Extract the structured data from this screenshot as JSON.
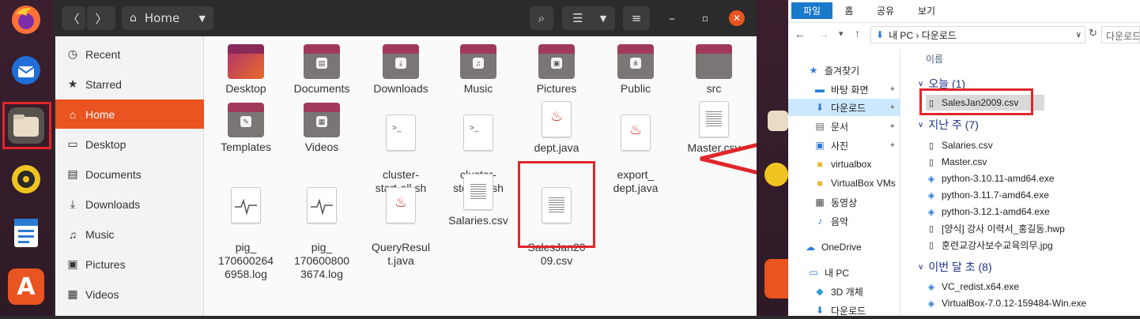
{
  "dock": {
    "items": [
      "firefox-icon",
      "thunderbird-icon",
      "files-icon",
      "rhythmbox-icon",
      "writer-icon",
      "app-center-icon"
    ]
  },
  "nautilus": {
    "path": "Home",
    "sidebar": [
      {
        "label": "Recent",
        "icon": "clock-icon"
      },
      {
        "label": "Starred",
        "icon": "star-icon"
      },
      {
        "label": "Home",
        "icon": "home-icon"
      },
      {
        "label": "Desktop",
        "icon": "desktop-icon"
      },
      {
        "label": "Documents",
        "icon": "documents-icon"
      },
      {
        "label": "Downloads",
        "icon": "downloads-icon"
      },
      {
        "label": "Music",
        "icon": "music-icon"
      },
      {
        "label": "Pictures",
        "icon": "pictures-icon"
      },
      {
        "label": "Videos",
        "icon": "videos-icon"
      }
    ],
    "files": [
      {
        "name": "Desktop",
        "type": "folder"
      },
      {
        "name": "Documents",
        "type": "folder"
      },
      {
        "name": "Downloads",
        "type": "folder"
      },
      {
        "name": "Music",
        "type": "folder"
      },
      {
        "name": "Pictures",
        "type": "folder"
      },
      {
        "name": "Public",
        "type": "folder"
      },
      {
        "name": "src",
        "type": "folder"
      },
      {
        "name": "Templates",
        "type": "folder"
      },
      {
        "name": "Videos",
        "type": "folder"
      },
      {
        "name": "cluster-\nstart-all.sh",
        "type": "script"
      },
      {
        "name": "cluster-\nstop-all.sh",
        "type": "script"
      },
      {
        "name": "dept.java",
        "type": "java"
      },
      {
        "name": "export_\ndept.java",
        "type": "java"
      },
      {
        "name": "Master.csv",
        "type": "csv"
      },
      {
        "name": "pig_\n170600264\n6958.log",
        "type": "log"
      },
      {
        "name": "pig_\n170600800\n3674.log",
        "type": "log"
      },
      {
        "name": "QueryResul\nt.java",
        "type": "java"
      },
      {
        "name": "Salaries.csv",
        "type": "csv"
      },
      {
        "name": "SalesJan20\n09.csv",
        "type": "csv"
      }
    ]
  },
  "explorer": {
    "tabs": [
      "파일",
      "홈",
      "공유",
      "보기"
    ],
    "address": "내 PC  ›  다운로드",
    "search_placeholder": "다운로드",
    "column": "이름",
    "sidebar": [
      {
        "label": "즐겨찾기",
        "icon": "star-icon",
        "pin": false
      },
      {
        "label": "바탕 화면",
        "icon": "desktop-icon",
        "pin": true
      },
      {
        "label": "다운로드",
        "icon": "download-icon",
        "pin": true
      },
      {
        "label": "문서",
        "icon": "documents-icon",
        "pin": true
      },
      {
        "label": "사진",
        "icon": "pictures-icon",
        "pin": true
      },
      {
        "label": "virtualbox",
        "icon": "folder-icon",
        "pin": false
      },
      {
        "label": "VirtualBox VMs",
        "icon": "folder-icon",
        "pin": false
      },
      {
        "label": "동영상",
        "icon": "videos-icon",
        "pin": false
      },
      {
        "label": "음악",
        "icon": "music-icon",
        "pin": false
      },
      {
        "label": "OneDrive",
        "icon": "cloud-icon",
        "pin": false
      },
      {
        "label": "내 PC",
        "icon": "pc-icon",
        "pin": false
      },
      {
        "label": "3D 개체",
        "icon": "cube-icon",
        "pin": false
      },
      {
        "label": "다운로드",
        "icon": "download-icon",
        "pin": false
      }
    ],
    "groups": [
      {
        "title": "오늘 (1)",
        "files": [
          "SalesJan2009.csv"
        ]
      },
      {
        "title": "지난 주 (7)",
        "files": [
          "Salaries.csv",
          "Master.csv",
          "python-3.10.11-amd64.exe",
          "python-3.11.7-amd64.exe",
          "python-3.12.1-amd64.exe",
          "[양식] 강사 이력서_홍길동.hwp",
          "훈련교강사보수교육의무.jpg"
        ]
      },
      {
        "title": "이번 달 초 (8)",
        "files": [
          "VC_redist.x64.exe",
          "VirtualBox-7.0.12-159484-Win.exe"
        ]
      }
    ]
  }
}
